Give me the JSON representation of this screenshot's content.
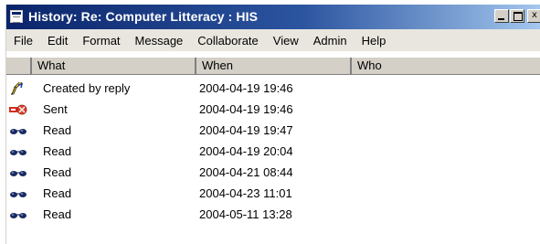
{
  "window": {
    "title": "History: Re: Computer Litteracy : HIS",
    "controls": {
      "minimize": "_",
      "maximize": "□",
      "close": "x"
    }
  },
  "menu": [
    "File",
    "Edit",
    "Format",
    "Message",
    "Collaborate",
    "View",
    "Admin",
    "Help"
  ],
  "table": {
    "columns": {
      "what": "What",
      "when": "When",
      "who": "Who"
    },
    "rows": [
      {
        "icon": "pencil-reply-icon",
        "what": "Created by reply",
        "when": "2004-04-19  19:46",
        "who": ""
      },
      {
        "icon": "sent-icon",
        "what": "Sent",
        "when": "2004-04-19  19:46",
        "who": ""
      },
      {
        "icon": "read-glasses-icon",
        "what": "Read",
        "when": "2004-04-19  19:47",
        "who": ""
      },
      {
        "icon": "read-glasses-icon",
        "what": "Read",
        "when": "2004-04-19  20:04",
        "who": ""
      },
      {
        "icon": "read-glasses-icon",
        "what": "Read",
        "when": "2004-04-21  08:44",
        "who": ""
      },
      {
        "icon": "read-glasses-icon",
        "what": "Read",
        "when": "2004-04-23  11:01",
        "who": ""
      },
      {
        "icon": "read-glasses-icon",
        "what": "Read",
        "when": "2004-05-11  13:28",
        "who": ""
      }
    ]
  },
  "colors": {
    "titlebar_start": "#0a246a",
    "titlebar_end": "#a6caf0",
    "menu_bg": "#e8e6df",
    "header_bg": "#d4d0c8"
  }
}
